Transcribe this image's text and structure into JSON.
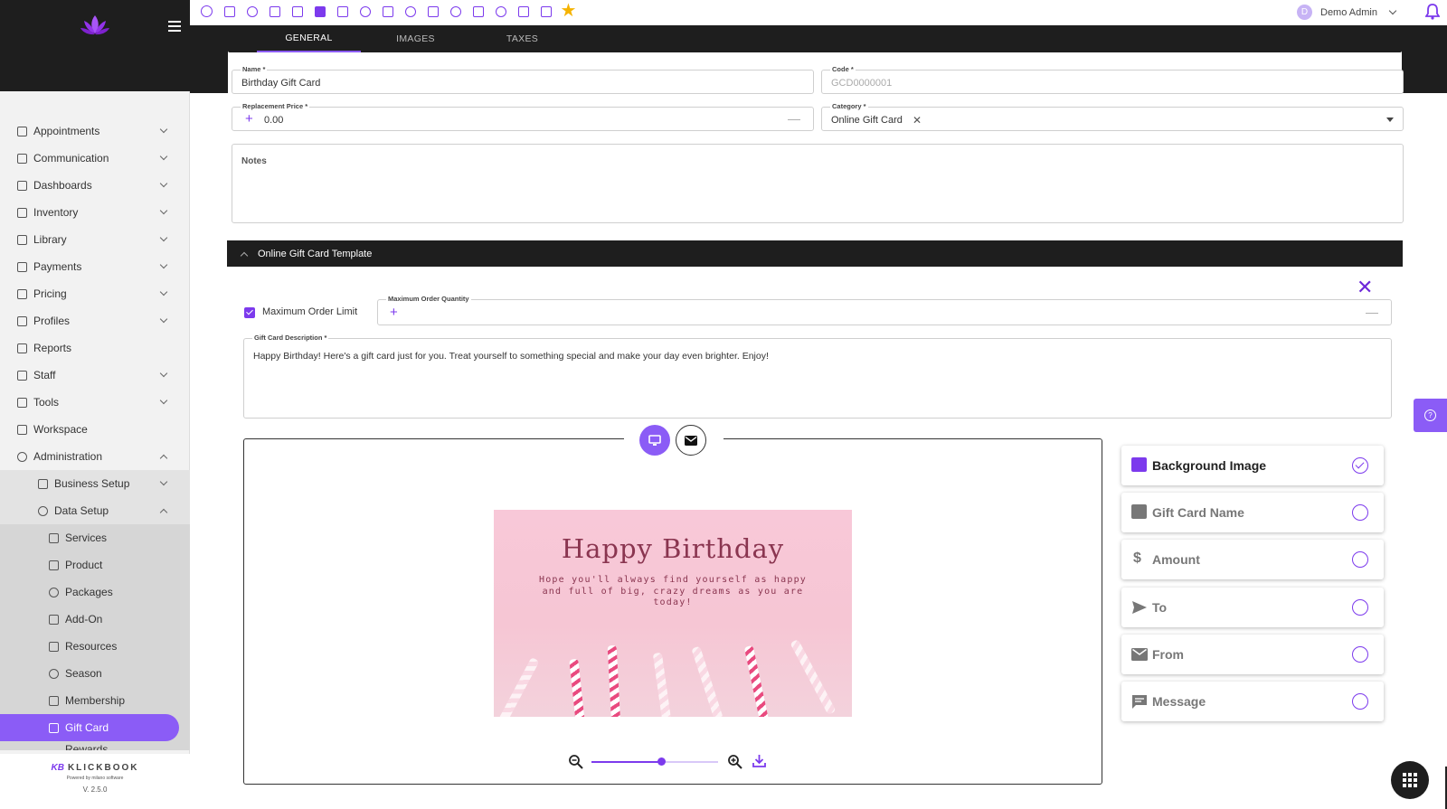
{
  "sidebar": {
    "items": [
      {
        "label": "Appointments"
      },
      {
        "label": "Communication"
      },
      {
        "label": "Dashboards"
      },
      {
        "label": "Inventory"
      },
      {
        "label": "Library"
      },
      {
        "label": "Payments"
      },
      {
        "label": "Pricing"
      },
      {
        "label": "Profiles"
      },
      {
        "label": "Reports"
      },
      {
        "label": "Staff"
      },
      {
        "label": "Tools"
      },
      {
        "label": "Workspace"
      },
      {
        "label": "Administration"
      }
    ],
    "admin_children": [
      {
        "label": "Business Setup"
      },
      {
        "label": "Data Setup"
      }
    ],
    "data_setup_children": [
      {
        "label": "Services"
      },
      {
        "label": "Product"
      },
      {
        "label": "Packages"
      },
      {
        "label": "Add-On"
      },
      {
        "label": "Resources"
      },
      {
        "label": "Season"
      },
      {
        "label": "Membership"
      },
      {
        "label": "Gift Card"
      },
      {
        "label": "Rewards"
      }
    ],
    "footer": {
      "brand": "KLICKBOOK",
      "mark": "KB",
      "powered": "Powered by milano software",
      "version": "V. 2.5.0"
    }
  },
  "topbar": {
    "icons": [
      "search-icon",
      "tune-icon",
      "spa-icon",
      "chair-icon",
      "grid-icon",
      "briefcase-icon",
      "id-card-icon",
      "tag-icon",
      "calendar-icon",
      "clock-icon",
      "list-icon",
      "face-icon",
      "scan-icon",
      "smile-icon",
      "split-icon",
      "chat-icon",
      "star-icon"
    ],
    "user": {
      "initial": "D",
      "name": "Demo Admin"
    }
  },
  "tabs": [
    {
      "label": "GENERAL",
      "active": true
    },
    {
      "label": "IMAGES",
      "active": false
    },
    {
      "label": "TAXES",
      "active": false
    }
  ],
  "form": {
    "name": {
      "label": "Name *",
      "value": "Birthday Gift Card"
    },
    "code": {
      "label": "Code *",
      "value": "GCD0000001"
    },
    "replacement_price": {
      "label": "Replacement Price *",
      "value": "0.00"
    },
    "category": {
      "label": "Category *",
      "value": "Online Gift Card"
    },
    "notes": {
      "label": "Notes",
      "value": ""
    }
  },
  "template_section": {
    "title": "Online Gift Card Template",
    "max_order_limit": {
      "label": "Maximum Order Limit",
      "checked": true
    },
    "max_order_quantity": {
      "label": "Maximum Order Quantity",
      "value": ""
    },
    "description": {
      "label": "Gift Card Description *",
      "value": "Happy Birthday! Here's a gift card just for you. Treat yourself to something special and make your day even brighter. Enjoy!"
    },
    "card": {
      "title": "Happy Birthday",
      "message": "Hope you'll always find yourself as happy and full of big, crazy dreams as you are today!"
    },
    "zoom_level": 0.55,
    "options": [
      {
        "label": "Background Image",
        "icon": "image-icon",
        "selected": true
      },
      {
        "label": "Gift Card Name",
        "icon": "monitor-icon",
        "selected": false
      },
      {
        "label": "Amount",
        "icon": "dollar-icon",
        "selected": false
      },
      {
        "label": "To",
        "icon": "send-icon",
        "selected": false
      },
      {
        "label": "From",
        "icon": "mail-icon",
        "selected": false
      },
      {
        "label": "Message",
        "icon": "message-icon",
        "selected": false
      }
    ]
  },
  "colors": {
    "accent": "#8b5cf6",
    "dark": "#1e1e1e",
    "star": "#f5b301"
  }
}
